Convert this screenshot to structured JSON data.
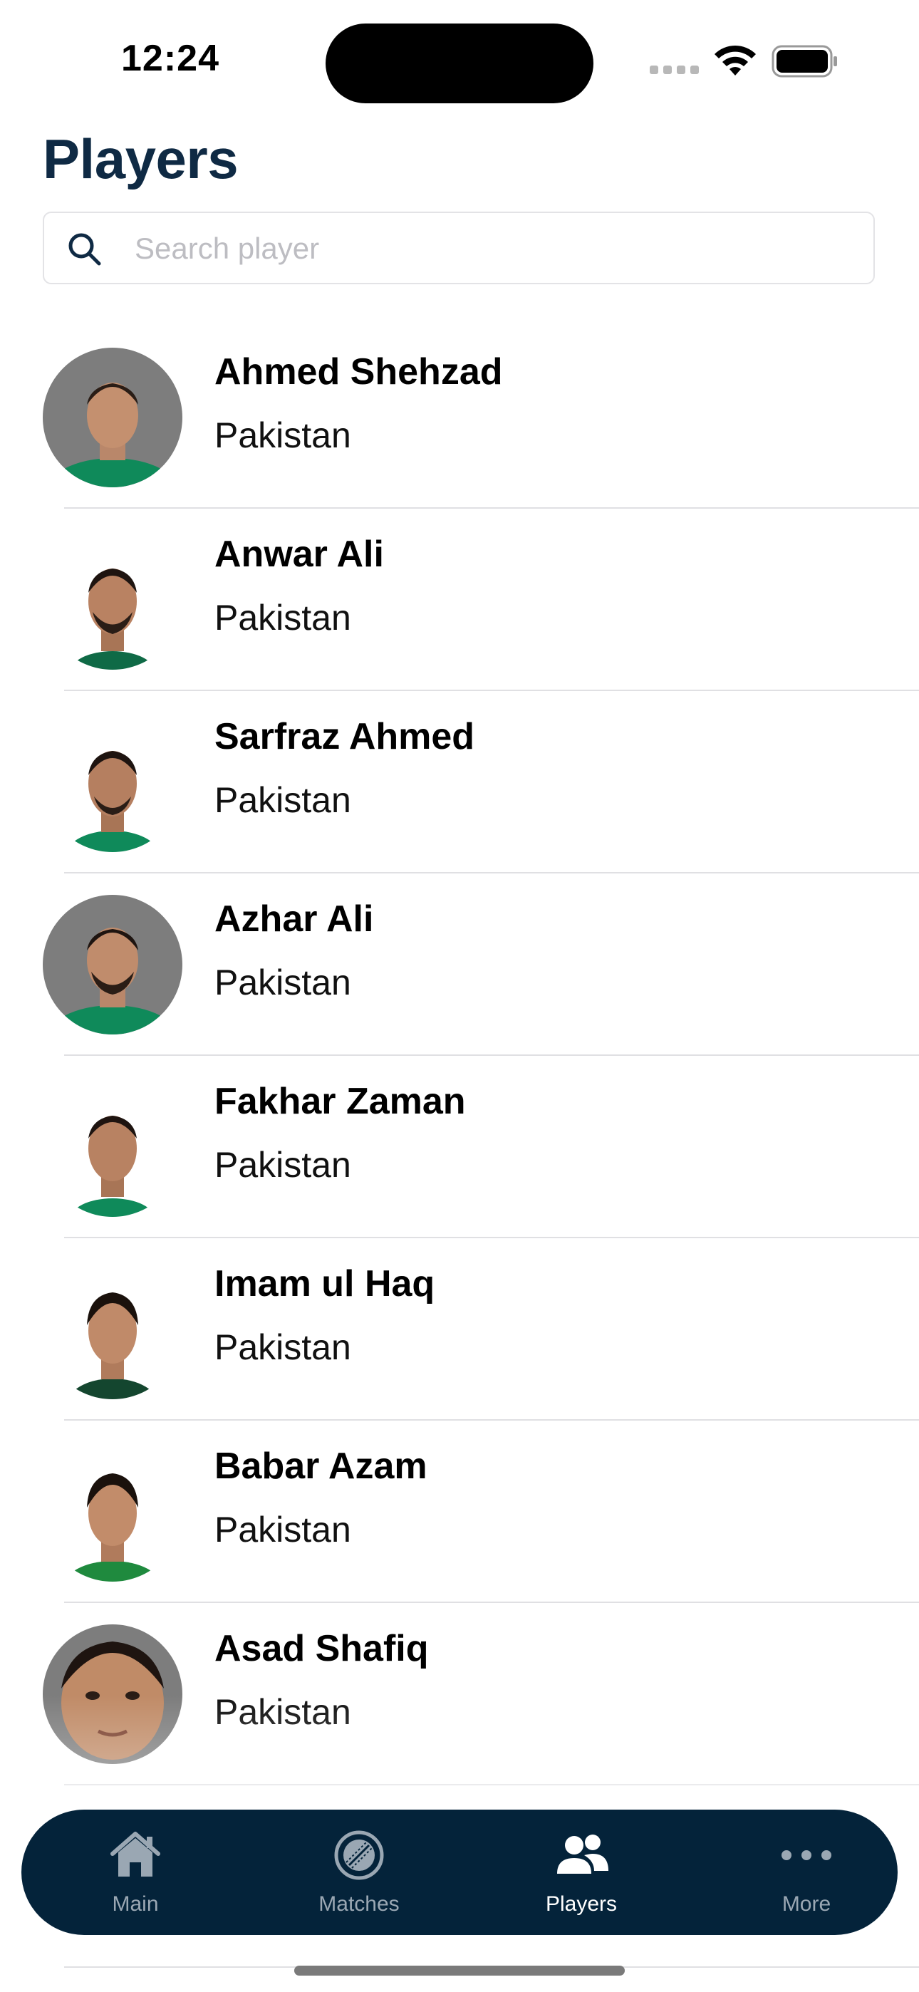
{
  "status_bar": {
    "time": "12:24"
  },
  "page": {
    "title": "Players"
  },
  "search": {
    "placeholder": "Search player",
    "value": ""
  },
  "players": [
    {
      "name": "Ahmed Shehzad",
      "country": "Pakistan",
      "avatar_bg": "gray"
    },
    {
      "name": "Anwar Ali",
      "country": "Pakistan",
      "avatar_bg": "white"
    },
    {
      "name": "Sarfraz Ahmed",
      "country": "Pakistan",
      "avatar_bg": "white"
    },
    {
      "name": "Azhar Ali",
      "country": "Pakistan",
      "avatar_bg": "gray"
    },
    {
      "name": "Fakhar Zaman",
      "country": "Pakistan",
      "avatar_bg": "white"
    },
    {
      "name": "Imam ul Haq",
      "country": "Pakistan",
      "avatar_bg": "white"
    },
    {
      "name": "Babar Azam",
      "country": "Pakistan",
      "avatar_bg": "white"
    },
    {
      "name": "Asad Shafiq",
      "country": "Pakistan",
      "avatar_bg": "gray"
    }
  ],
  "tab_bar": {
    "tabs": [
      {
        "label": "Main",
        "icon": "house-icon",
        "active": false
      },
      {
        "label": "Matches",
        "icon": "cricket-ball-icon",
        "active": false
      },
      {
        "label": "Players",
        "icon": "people-icon",
        "active": true
      },
      {
        "label": "More",
        "icon": "ellipsis-icon",
        "active": false
      }
    ]
  },
  "colors": {
    "title": "#0f2a44",
    "tab_bar_bg": "#04233a",
    "tab_inactive": "#9aa7b3",
    "tab_active": "#ffffff",
    "jersey_green": "#0f8a5a"
  }
}
